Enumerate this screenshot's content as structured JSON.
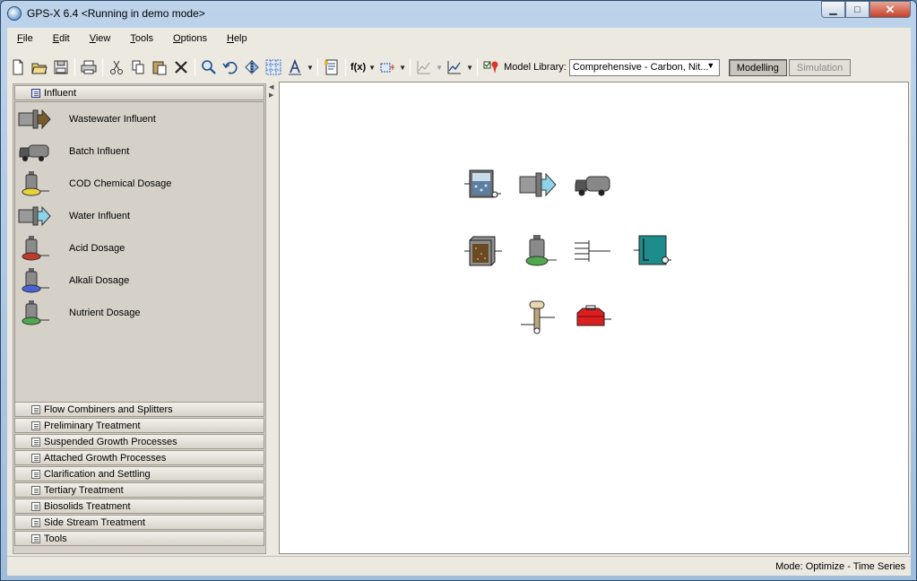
{
  "window": {
    "title": "GPS-X 6.4 <Running in demo mode>",
    "minimize": "▁",
    "maximize": "□",
    "close": "✕"
  },
  "menu": [
    "File",
    "Edit",
    "View",
    "Tools",
    "Options",
    "Help"
  ],
  "toolbar": {
    "fx_label": "f(x)",
    "model_library_label": "Model Library:",
    "model_library_value": "Comprehensive - Carbon, Nit...",
    "modelling_label": "Modelling",
    "simulation_label": "Simulation"
  },
  "panel": {
    "open_category": "Influent",
    "components": [
      "Wastewater Influent",
      "Batch Influent",
      "COD Chemical Dosage",
      "Water Influent",
      "Acid Dosage",
      "Alkali Dosage",
      "Nutrient Dosage"
    ],
    "categories": [
      "Flow Combiners and Splitters",
      "Preliminary Treatment",
      "Suspended Growth Processes",
      "Attached Growth Processes",
      "Clarification and Settling",
      "Tertiary Treatment",
      "Biosolids Treatment",
      "Side Stream Treatment",
      "Tools"
    ]
  },
  "status": {
    "mode": "Mode: Optimize - Time Series"
  },
  "colors": {
    "dosage_yellow": "#e6d23a",
    "dosage_red": "#c0392b",
    "dosage_blue": "#4a62d8",
    "dosage_green": "#4fa84c",
    "tank_teal": "#1c8c8c"
  }
}
